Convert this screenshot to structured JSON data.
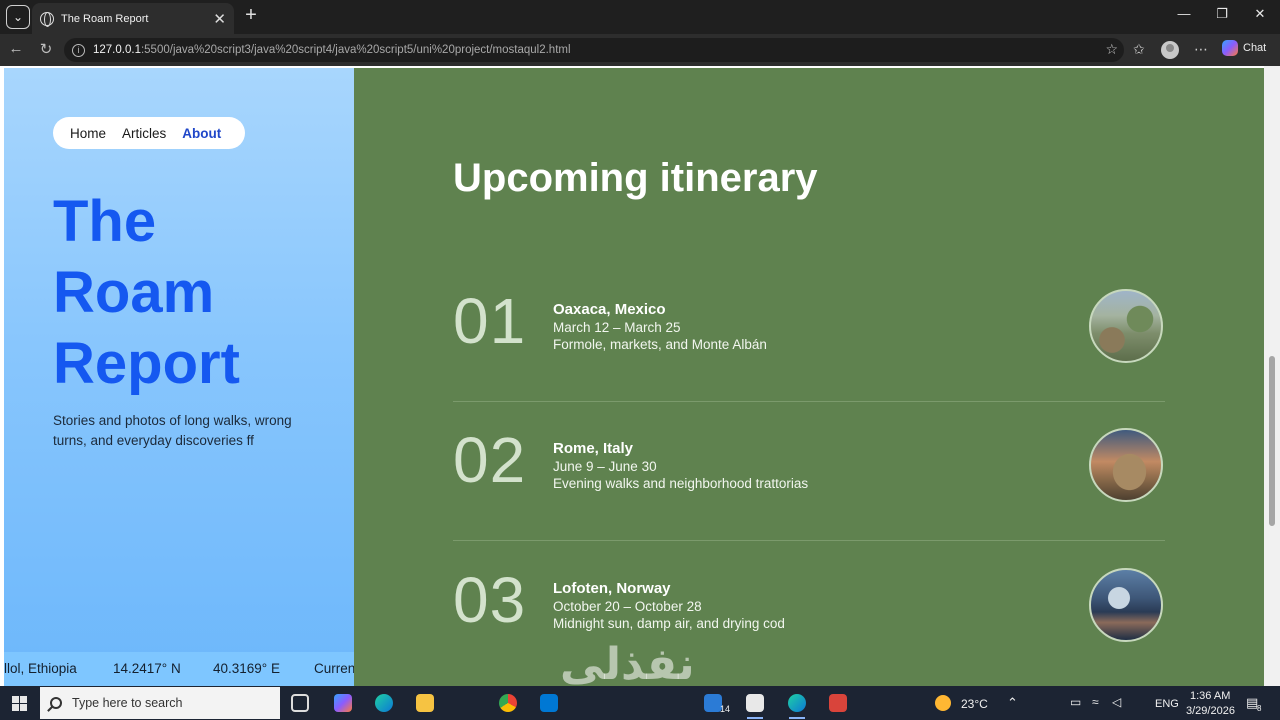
{
  "browser": {
    "tab_title": "The Roam Report",
    "tab_close": "✕",
    "new_tab": "+",
    "url_host": "127.0.0.1",
    "url_path": ":5500/java%20script3/java%20script4/java%20script5/uni%20project/mostaqul2.html",
    "chat_label": "Chat"
  },
  "nav": {
    "items": [
      "Home",
      "Articles",
      "About"
    ],
    "active": "About"
  },
  "site": {
    "title_lines": [
      "The",
      "Roam",
      "Report"
    ],
    "tagline": "Stories and photos of long walks, wrong turns, and everyday discoveries ff"
  },
  "ticker": {
    "items": [
      "llol, Ethiopia",
      "14.2417° N",
      "40.3169° E",
      "Curren"
    ]
  },
  "itinerary": {
    "title": "Upcoming itinerary",
    "items": [
      {
        "num": "01",
        "place": "Oaxaca, Mexico",
        "dates": "March 12 – March 25",
        "desc": "Formole, markets, and Monte Albán"
      },
      {
        "num": "02",
        "place": "Rome, Italy",
        "dates": "June 9 – June 30",
        "desc": "Evening walks and neighborhood trattorias"
      },
      {
        "num": "03",
        "place": "Lofoten, Norway",
        "dates": "October 20 – October 28",
        "desc": "Midnight sun, damp air, and drying cod"
      }
    ]
  },
  "watermark": "نفذلي",
  "taskbar": {
    "search_placeholder": "Type here to search",
    "temperature": "23°C",
    "language": "ENG",
    "time": "1:36 AM",
    "date": "3/29/2026",
    "notification_count": "8",
    "badge_count": "14"
  },
  "colors": {
    "sidebar_blue": "#88c6fd",
    "title_blue": "#1558f0",
    "content_green": "#5f824f",
    "nav_active": "#2047c9"
  },
  "icons": {
    "tab": "globe-icon",
    "nav_back": "arrow-left-icon",
    "nav_reload": "reload-icon",
    "site_info": "info-icon",
    "favorite": "star-icon",
    "collections": "collections-icon",
    "more": "ellipsis-icon"
  }
}
